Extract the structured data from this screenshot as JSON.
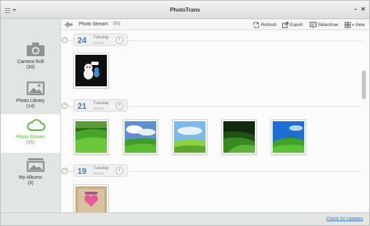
{
  "window": {
    "title": "PhotoTrans",
    "minimize": "–",
    "close": "✕"
  },
  "sidebar": {
    "items": [
      {
        "label": "Camera Roll",
        "count": "(30)",
        "icon": "camera-icon",
        "active": false
      },
      {
        "label": "Photo Library",
        "count": "(14)",
        "icon": "picture-icon",
        "active": false
      },
      {
        "label": "Photo Stream",
        "count": "(55)",
        "icon": "cloud-icon",
        "active": true
      },
      {
        "label": "My Albums",
        "count": "(3)",
        "icon": "album-icon",
        "active": false
      }
    ]
  },
  "toolbar": {
    "title": "Photo Stream",
    "count": "(55)",
    "refresh": "Refresh",
    "export": "Export",
    "slideshow": "Slideshow",
    "view": "View"
  },
  "days": [
    {
      "day": "24",
      "weekday": "Tuesday",
      "date": "03/2012",
      "count": "1"
    },
    {
      "day": "21",
      "weekday": "Tuesday",
      "date": "03/2012",
      "count": "5"
    },
    {
      "day": "19",
      "weekday": "Tuesday",
      "date": "03/2012",
      "count": "1"
    }
  ],
  "collapse_symbol": "−",
  "status": {
    "check_updates": "Check for Updates"
  },
  "colors": {
    "accent_green": "#5bb13e",
    "date_blue": "#4a7bb5",
    "link_blue": "#3a6fb0"
  }
}
